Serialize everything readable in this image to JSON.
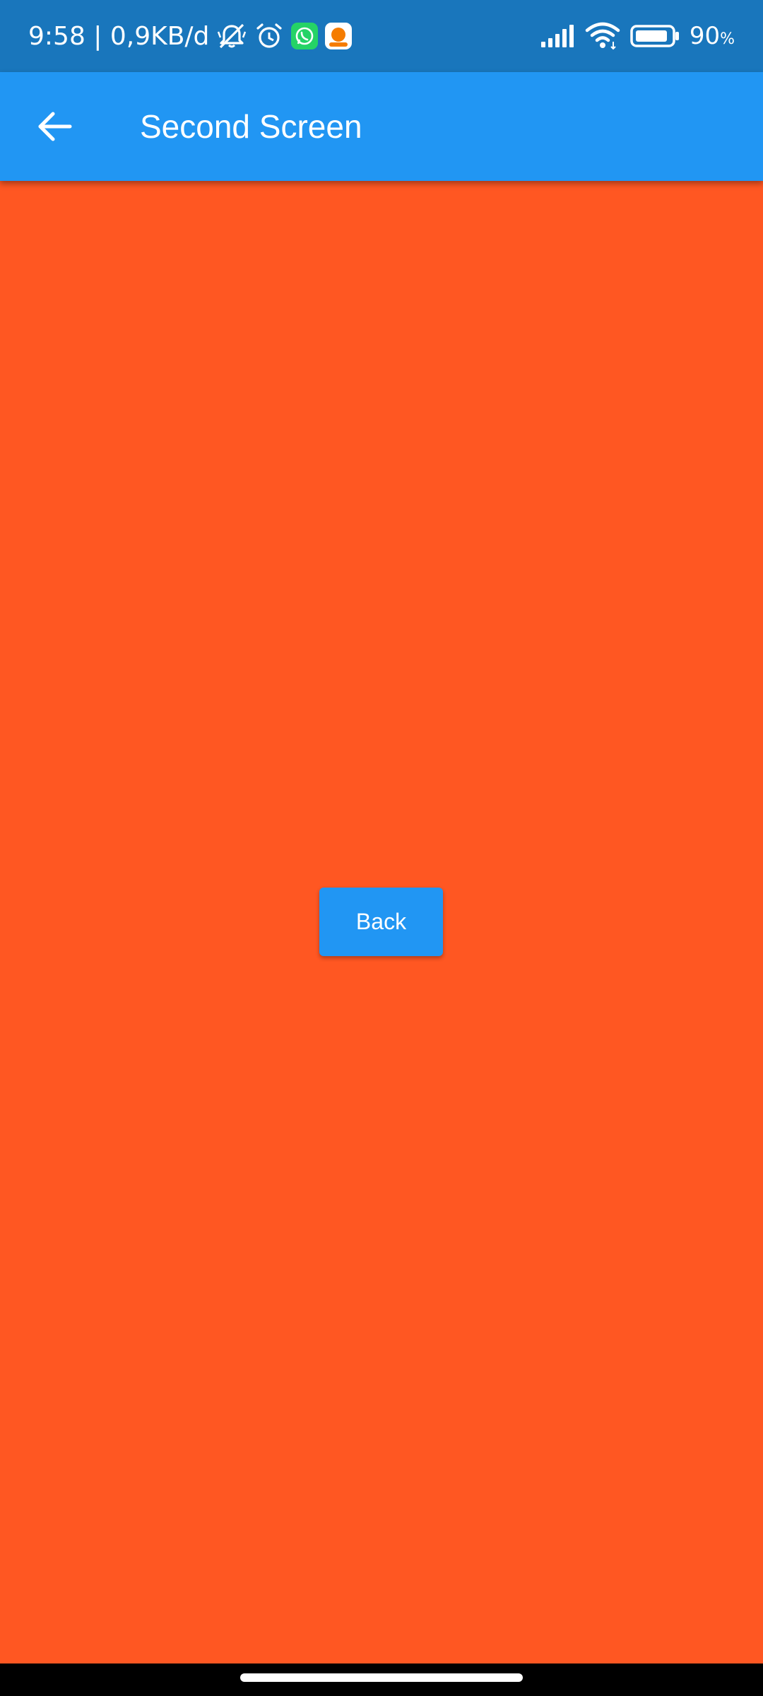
{
  "status_bar": {
    "time_speed": "9:58 | 0,9KB/d",
    "battery_percent": "90",
    "battery_unit": "%",
    "icons": [
      "mute-bell-icon",
      "alarm-icon",
      "whatsapp-icon",
      "app-notification-icon",
      "signal-icon",
      "wifi-icon",
      "battery-icon"
    ],
    "background_color": "#1976BC"
  },
  "app_bar": {
    "title": "Second Screen",
    "back_icon": "arrow-back-icon",
    "background_color": "#2196F3"
  },
  "main": {
    "background_color": "#FF5722",
    "back_button_label": "Back"
  }
}
